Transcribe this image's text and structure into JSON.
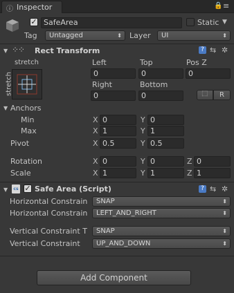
{
  "tab": {
    "title": "Inspector"
  },
  "tab_icons": {
    "lock": "lock-icon",
    "menu": "tab-menu-icon"
  },
  "gameobject": {
    "name": "SafeArea",
    "static_label": "Static",
    "tag_label": "Tag",
    "tag_value": "Untagged",
    "layer_label": "Layer",
    "layer_value": "UI"
  },
  "rect_transform": {
    "title": "Rect Transform",
    "anchor_preset_h": "stretch",
    "anchor_preset_v": "stretch",
    "left_label": "Left",
    "left_value": "0",
    "top_label": "Top",
    "top_value": "0",
    "posz_label": "Pos Z",
    "posz_value": "0",
    "right_label": "Right",
    "right_value": "0",
    "bottom_label": "Bottom",
    "bottom_value": "0",
    "raw_button": "R",
    "anchors_label": "Anchors",
    "min_label": "Min",
    "min_x": "0",
    "min_y": "0",
    "max_label": "Max",
    "max_x": "1",
    "max_y": "1",
    "pivot_label": "Pivot",
    "pivot_x": "0.5",
    "pivot_y": "0.5",
    "rotation_label": "Rotation",
    "rot_x": "0",
    "rot_y": "0",
    "rot_z": "0",
    "scale_label": "Scale",
    "scale_x": "1",
    "scale_y": "1",
    "scale_z": "1",
    "axis_x": "X",
    "axis_y": "Y",
    "axis_z": "Z"
  },
  "safe_area": {
    "title": "Safe Area (Script)",
    "hconst1_label": "Horizontal Constrain",
    "hconst1_value": "SNAP",
    "hconst2_label": "Horizontal Constrain",
    "hconst2_value": "LEFT_AND_RIGHT",
    "vconst1_label": "Vertical Constraint T",
    "vconst1_value": "SNAP",
    "vconst2_label": "Vertical Constraint",
    "vconst2_value": "UP_AND_DOWN"
  },
  "footer": {
    "add_component": "Add Component"
  }
}
